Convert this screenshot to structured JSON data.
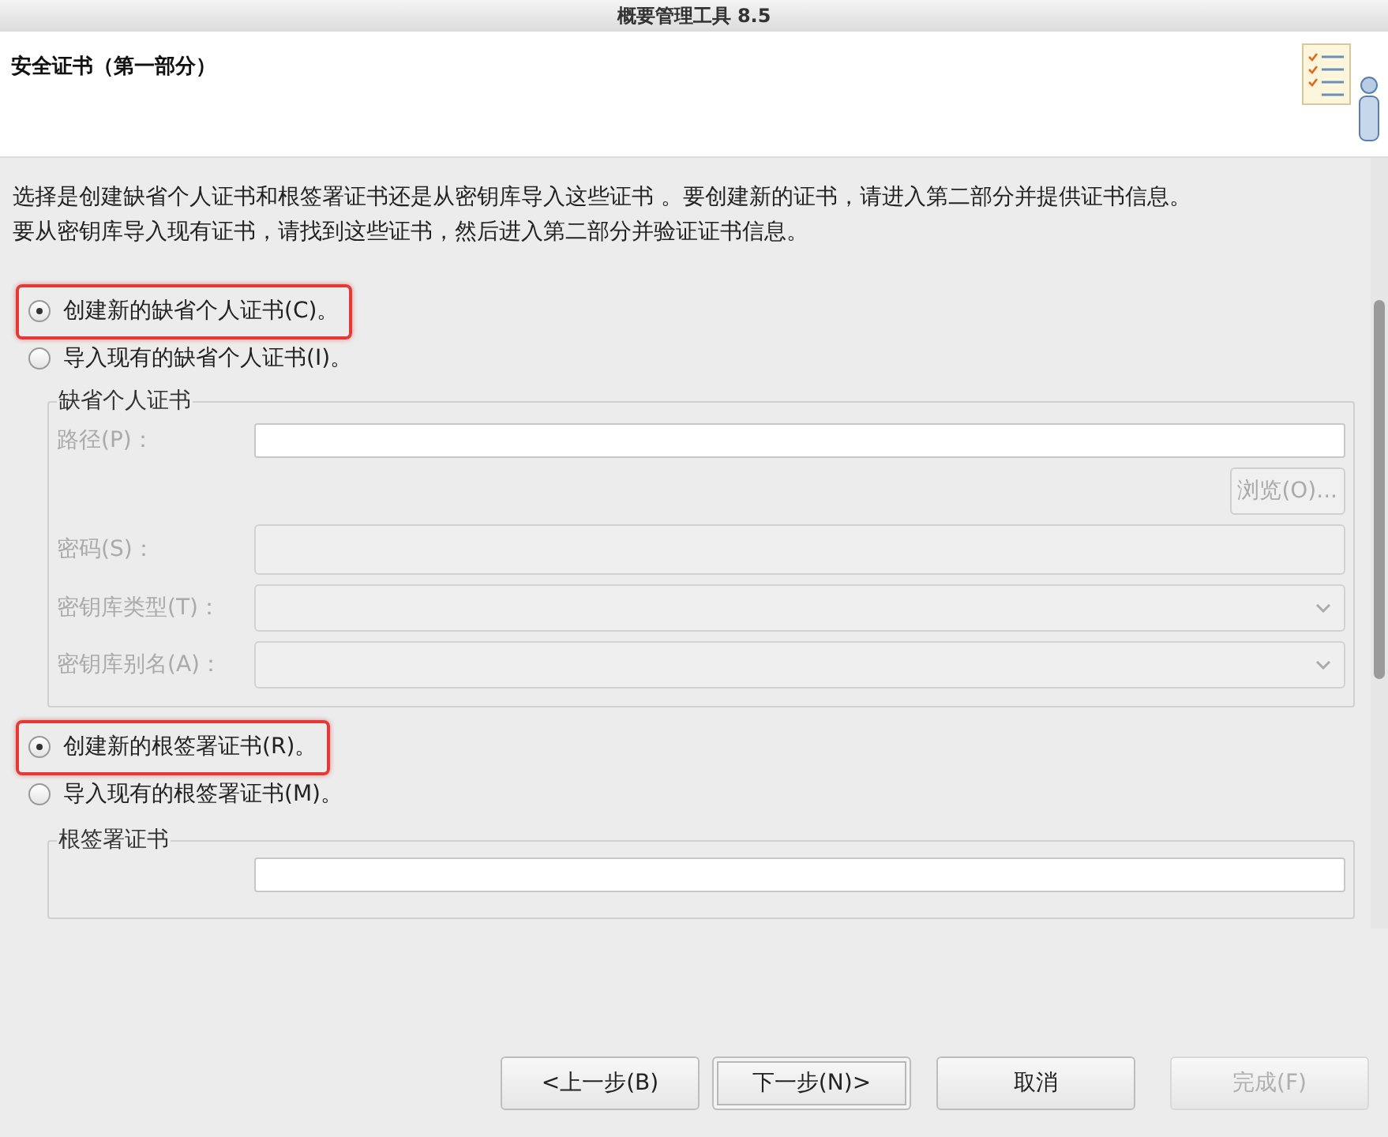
{
  "window": {
    "title": "概要管理工具 8.5"
  },
  "header": {
    "title": "安全证书（第一部分）"
  },
  "description": [
    "选择是创建缺省个人证书和根签署证书还是从密钥库导入这些证书 。要创建新的证书，请进入第二部分并提供证书信息。",
    "要从密钥库导入现有证书，请找到这些证书，然后进入第二部分并验证证书信息。"
  ],
  "personal_options": [
    {
      "label": "创建新的缺省个人证书(C)。",
      "selected": true,
      "highlighted": true
    },
    {
      "label": "导入现有的缺省个人证书(I)。",
      "selected": false,
      "highlighted": false
    }
  ],
  "personal_group": {
    "legend": "缺省个人证书",
    "fields": [
      {
        "kind": "text",
        "label": "路径(P)："
      },
      {
        "kind": "button",
        "label": "浏览(O)..."
      },
      {
        "kind": "password",
        "label": "密码(S)："
      },
      {
        "kind": "select",
        "label": "密钥库类型(T)："
      },
      {
        "kind": "select",
        "label": "密钥库别名(A)："
      }
    ]
  },
  "root_options": [
    {
      "label": "创建新的根签署证书(R)。",
      "selected": true,
      "highlighted": true
    },
    {
      "label": "导入现有的根签署证书(M)。",
      "selected": false,
      "highlighted": false
    }
  ],
  "root_group": {
    "legend": "根签署证书"
  },
  "buttons": [
    {
      "label": "<上一步(B)",
      "disabled": false,
      "focused": false
    },
    {
      "label": "下一步(N)>",
      "disabled": false,
      "focused": true
    },
    {
      "label": "取消",
      "disabled": false,
      "focused": false
    },
    {
      "label": "完成(F)",
      "disabled": true,
      "focused": false
    }
  ]
}
